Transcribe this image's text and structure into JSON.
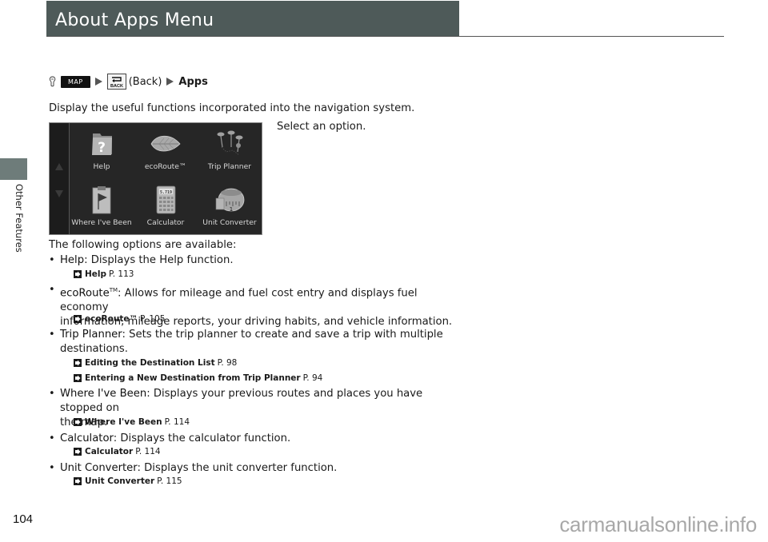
{
  "header": {
    "title": "About Apps Menu"
  },
  "side_tab": {
    "label": "Other Features"
  },
  "nav_path": {
    "map_button": "MAP",
    "back_label": "(Back)",
    "target": "Apps"
  },
  "intro": "Display the useful functions incorporated into the navigation system.",
  "select_prompt": "Select an option.",
  "screen": {
    "apps": [
      {
        "label": "Help",
        "icon": "help-folder-icon"
      },
      {
        "label": "ecoRoute™",
        "icon": "leaf-icon"
      },
      {
        "label": "Trip Planner",
        "icon": "pushpins-icon"
      },
      {
        "label": "Where I've Been",
        "icon": "clipboard-flag-icon"
      },
      {
        "label": "Calculator",
        "icon": "calculator-icon"
      },
      {
        "label": "Unit Converter",
        "icon": "measuring-tape-icon"
      }
    ],
    "calculator_display": "5.719"
  },
  "options_heading": "The following options are available:",
  "options": [
    {
      "name": "Help",
      "desc": ": Displays the Help function.",
      "desc_cont": "",
      "refs": [
        {
          "title": "Help",
          "page": "P. 113"
        }
      ]
    },
    {
      "name": "ecoRoute",
      "sup": "TM",
      "desc": ": Allows for mileage and fuel cost entry and displays fuel economy",
      "desc_cont": "information, mileage reports, your driving habits, and vehicle information.",
      "refs": [
        {
          "title": "ecoRoute™",
          "page": "P. 105"
        }
      ]
    },
    {
      "name": "Trip Planner",
      "desc": ": Sets the trip planner to create and save a trip with multiple",
      "desc_cont": "destinations.",
      "refs": [
        {
          "title": "Editing the Destination List",
          "page": "P. 98"
        },
        {
          "title": "Entering a New Destination from Trip Planner",
          "page": "P. 94"
        }
      ]
    },
    {
      "name": "Where I've Been",
      "desc": ": Displays your previous routes and places you have stopped on",
      "desc_cont": "the map.",
      "refs": [
        {
          "title": "Where I've Been",
          "page": "P. 114"
        }
      ]
    },
    {
      "name": "Calculator",
      "desc": ": Displays the calculator function.",
      "desc_cont": "",
      "refs": [
        {
          "title": "Calculator",
          "page": "P. 114"
        }
      ]
    },
    {
      "name": "Unit Converter",
      "desc": ": Displays the unit converter function.",
      "desc_cont": "",
      "refs": [
        {
          "title": "Unit Converter",
          "page": "P. 115"
        }
      ]
    }
  ],
  "footer": {
    "page_number": "104",
    "watermark": "carmanualsonline.info"
  },
  "colors": {
    "title_bar": "#4e5a59",
    "side_tab": "#6e7c7a",
    "screen_bg": "#262626"
  }
}
